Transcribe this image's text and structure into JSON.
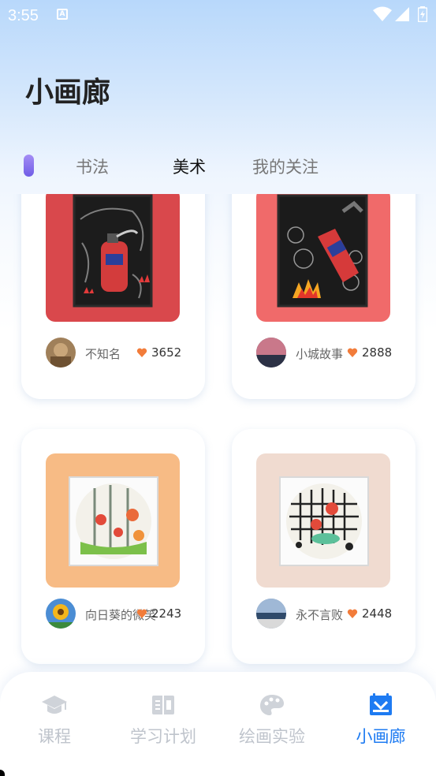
{
  "status_bar": {
    "time": "3:55",
    "notif_letter": "A"
  },
  "page": {
    "title": "小画廊"
  },
  "tabs": [
    {
      "label": "书法",
      "active": false
    },
    {
      "label": "美术",
      "active": true
    },
    {
      "label": "我的关注",
      "active": false
    }
  ],
  "gallery": [
    {
      "author": "不知名",
      "likes": "3652",
      "art_bg": "#d9484c",
      "avatar_color": "#a0805a"
    },
    {
      "author": "小城故事",
      "likes": "2888",
      "art_bg": "#f06a6a",
      "avatar_color": "#5b5570"
    },
    {
      "author": "向日葵的微笑",
      "likes": "2243",
      "art_bg": "#f7bb85",
      "avatar_color": "#e8b92a"
    },
    {
      "author": "永不言败",
      "likes": "2448",
      "art_bg": "#f0dbd0",
      "avatar_color": "#6f8fb0"
    }
  ],
  "bottom_nav": [
    {
      "label": "课程",
      "icon": "graduation-cap-icon",
      "active": false
    },
    {
      "label": "学习计划",
      "icon": "notebook-icon",
      "active": false
    },
    {
      "label": "绘画实验",
      "icon": "palette-icon",
      "active": false
    },
    {
      "label": "小画廊",
      "icon": "gallery-icon",
      "active": true
    }
  ],
  "colors": {
    "accent": "#1e7bf2",
    "heart": "#f27c3a",
    "tab_indicator": "#8a75ee"
  }
}
